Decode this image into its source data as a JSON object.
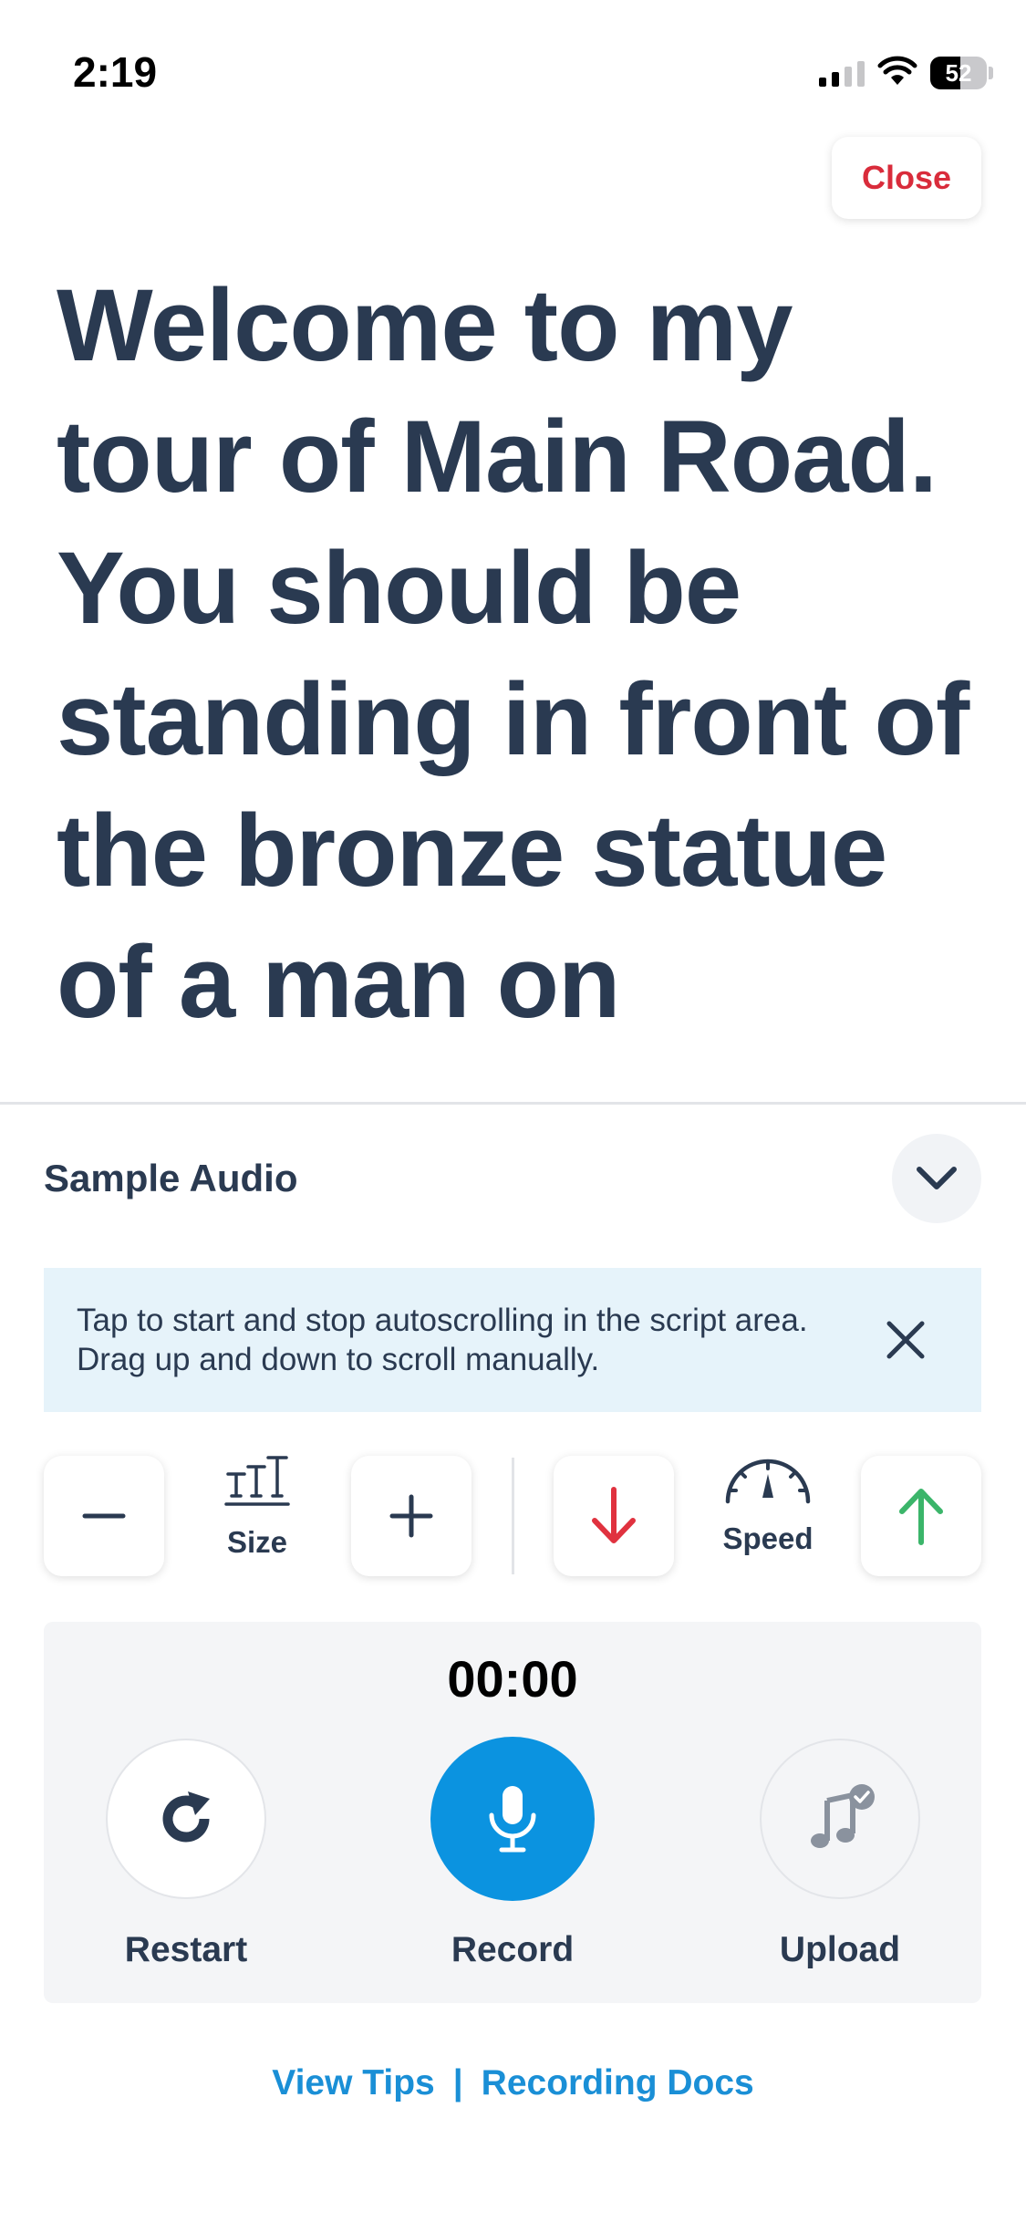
{
  "status_bar": {
    "time": "2:19",
    "battery": "52",
    "icons": [
      "cellular-signal-icon",
      "wifi-icon",
      "battery-icon"
    ]
  },
  "header": {
    "close_label": "Close"
  },
  "script": {
    "text": "Welcome to my tour of Main Road. You should be standing in front of the bronze statue of a man on"
  },
  "audio_panel": {
    "title": "Sample Audio",
    "collapse_icon": "chevron-down-icon",
    "tip": {
      "text": "Tap to start and stop autoscrolling in the script area. Drag up and down to scroll manually.",
      "dismiss_icon": "close-icon"
    },
    "controls": {
      "size_label": "Size",
      "speed_label": "Speed",
      "decrease_icon": "minus-icon",
      "increase_icon": "plus-icon",
      "slower_icon": "arrow-down-icon",
      "faster_icon": "arrow-up-icon"
    },
    "recorder": {
      "timer": "00:00",
      "restart_label": "Restart",
      "record_label": "Record",
      "upload_label": "Upload"
    }
  },
  "footer": {
    "view_tips": "View Tips",
    "separator": "|",
    "recording_docs": "Recording Docs"
  },
  "colors": {
    "text": "#2a3a51",
    "close": "#d92c3b",
    "accent": "#0b93e0",
    "link": "#1a8fd6",
    "down_arrow": "#e0323f",
    "up_arrow": "#3bb56a",
    "tip_background": "#e6f3fa"
  }
}
